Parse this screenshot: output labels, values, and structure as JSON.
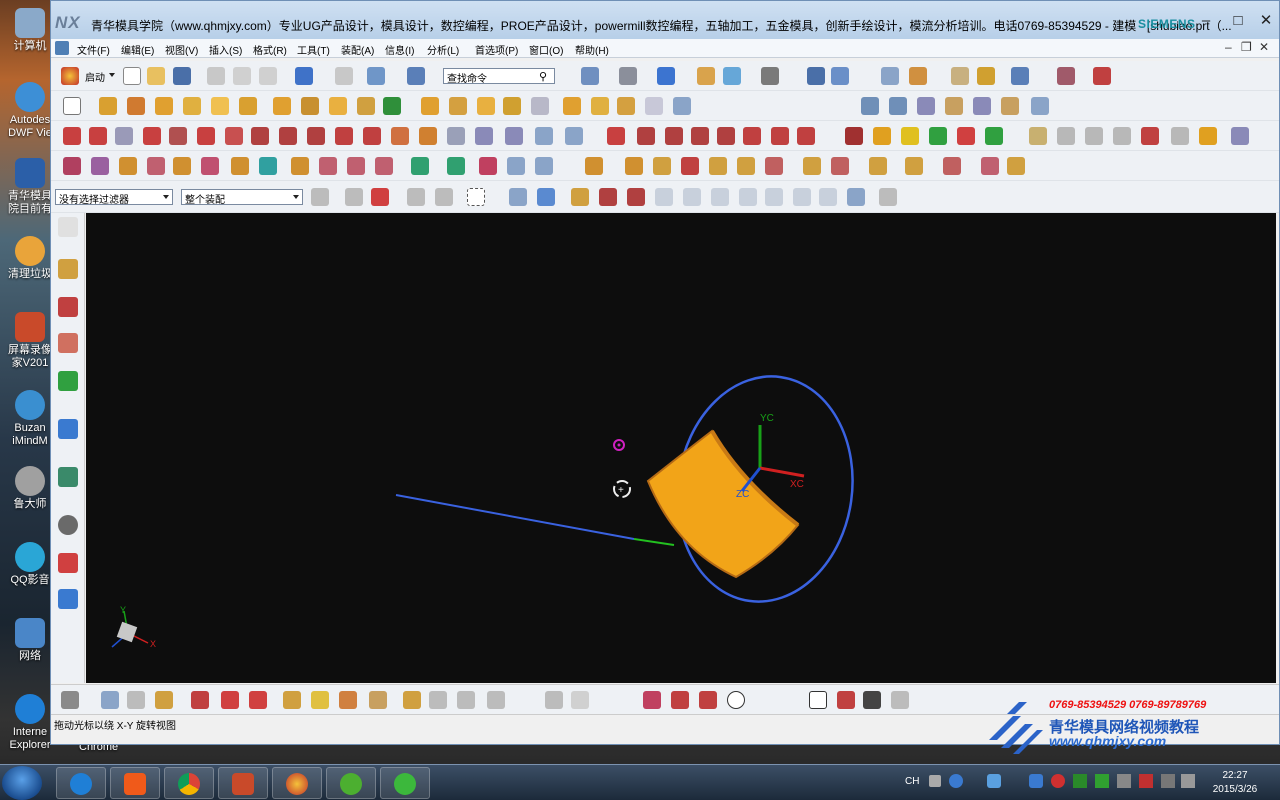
{
  "desktop_icons": [
    {
      "label": "计算机",
      "icon": "computer-icon",
      "color": "#8aa9c9"
    },
    {
      "label": "Autodes\nDWF Vie",
      "icon": "dwf-viewer-icon",
      "color": "#3d8fd6"
    },
    {
      "label": "青华模具\n院目前有",
      "icon": "word-doc-icon",
      "color": "#2b5fa8"
    },
    {
      "label": "清理垃圾",
      "icon": "cleanup-icon",
      "color": "#e9a43a"
    },
    {
      "label": "屏幕录像\n家V201",
      "icon": "screen-recorder-icon",
      "color": "#c94a2a"
    },
    {
      "label": "Buzan\niMindM",
      "icon": "imindmap-icon",
      "color": "#3a8fd0"
    },
    {
      "label": "鲁大师",
      "icon": "ludashi-icon",
      "color": "#a0a0a0"
    },
    {
      "label": "QQ影音",
      "icon": "qq-player-icon",
      "color": "#2aa6d6"
    },
    {
      "label": "网络",
      "icon": "network-icon",
      "color": "#4a86c8"
    },
    {
      "label": "Interne\nExplorer",
      "icon": "ie-icon",
      "color": "#1f7fd6"
    }
  ],
  "chrome_label": "Chrome",
  "window": {
    "logo": "NX",
    "title": "青华模具学院（www.qhmjxy.com）专业UG产品设计，模具设计，数控编程，PROE产品设计，powermill数控编程，五轴加工，五金模具，创新手绘设计，模流分析培训。电话0769-85394529 - 建模 - [shubiao.prt（...",
    "brand": "SIEMENS"
  },
  "menu": [
    "文件(F)",
    "编辑(E)",
    "视图(V)",
    "插入(S)",
    "格式(R)",
    "工具(T)",
    "装配(A)",
    "信息(I)",
    "分析(L)",
    "首选项(P)",
    "窗口(O)",
    "帮助(H)"
  ],
  "toolbar": {
    "start_label": "启动",
    "search_placeholder": "查找命令"
  },
  "filter": {
    "selection": "没有选择过滤器",
    "assembly": "整个装配"
  },
  "viewport": {
    "axis_labels": {
      "yc": "YC",
      "xc": "XC",
      "zc": "ZC"
    },
    "triad": {
      "y": "Y",
      "x": "X"
    },
    "colors": {
      "part": "#f2a418",
      "circle": "#3a62e0",
      "line": "#3a62e0",
      "accent_green": "#23c020",
      "yc": "#18a018",
      "xc": "#d02020",
      "zc": "#2050d0",
      "background": "#0d0d0d"
    }
  },
  "status": "拖动光标以绕 X-Y 旋转视图",
  "watermark": {
    "phones": "0769-85394529  0769-89789769",
    "name": "青华模具网络视频教程",
    "url": "www.qhmjxy.com"
  },
  "tray": {
    "lang": "CH",
    "time": "22:27",
    "date": "2015/3/26"
  }
}
